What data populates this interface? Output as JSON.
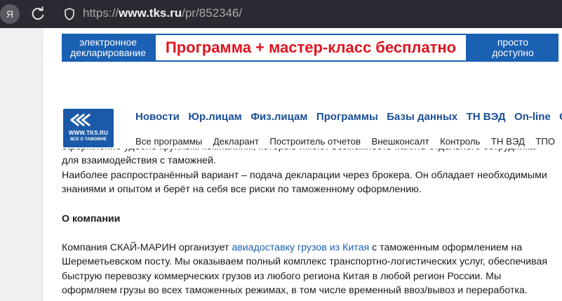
{
  "browser": {
    "yandex_label": "Я",
    "url_prefix": "https://",
    "url_domain": "www.tks.ru",
    "url_path": "/pr/852346/"
  },
  "banner": {
    "left_line1": "электронное",
    "left_line2": "декларирование",
    "middle": "Программа + мастер-класс бесплатно",
    "right_line1": "просто",
    "right_line2": "доступно"
  },
  "logo": {
    "title": "WWW.TKS.RU",
    "subtitle": "ВСЕ О ТАМОЖНЕ"
  },
  "main_nav": [
    "Новости",
    "Юр.лицам",
    "Физ.лицам",
    "Программы",
    "Базы данных",
    "ТН ВЭД",
    "On-line",
    "С"
  ],
  "sub_nav": [
    "Все программы",
    "Декларант",
    "Построитель отчетов",
    "Внешконсалт",
    "Контроль",
    "ТН ВЭД",
    "ТПО"
  ],
  "article": {
    "line1": "оформление удобно крупным компаниям, которые имеют возможность нанять отдельного сотрудника",
    "line2": "для взаимодействия с таможней.",
    "line3": "Наиболее распространённый вариант – подача декларации через брокера. Он обладает необходимыми",
    "line4": "знаниями и опытом и берёт на себя все риски по таможенному оформлению.",
    "heading": "О компании",
    "p2_start": "Компания СКАЙ-МАРИН организует ",
    "p2_link": "авиадоставку грузов из Китая",
    "p2_end": " с таможенным оформлением на",
    "line6": "Шереметьевском посту. Мы оказываем полный комплекс транспортно-логистических услуг, обеспечивая",
    "line7": "быструю перевозку коммерческих грузов из любого региона Китая в любой регион России. Мы",
    "line8": "оформляем грузы во всех таможенных режимах, в том числе временный ввоз/вывоз и переработка."
  },
  "colors": {
    "chrome_bg": "#2b2a33",
    "banner_blue": "#1a60b3",
    "banner_red": "#e0151f",
    "nav_blue": "#1b4f97",
    "link_blue": "#1f5fb0"
  }
}
